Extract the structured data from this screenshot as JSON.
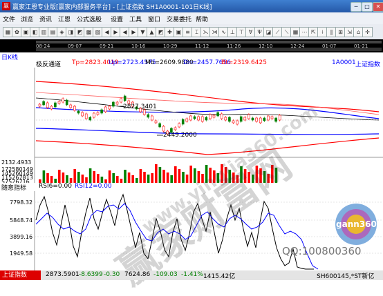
{
  "app": {
    "title": "赢家江恩专业版[赢家内部服务平台] - [上证指数  SH1A0001-101日K线]",
    "logo_text": "赢"
  },
  "window_buttons": [
    "─",
    "□",
    "✕"
  ],
  "menu": [
    "文件",
    "浏览",
    "资讯",
    "江恩",
    "公式选股",
    "设置",
    "工具",
    "窗口",
    "交易委托",
    "帮助"
  ],
  "toolbar": [
    "▦",
    "✿",
    "▣",
    "◧",
    "▥",
    "▤",
    "◈",
    "◨",
    "◩",
    "▩",
    "▧",
    "◀",
    "▶",
    "◀",
    "▶",
    "▼",
    "▲",
    "◩",
    "✚",
    "▣",
    "≡",
    "⌶",
    "⋋",
    "⋊",
    "∿",
    "⊥",
    "⊤",
    "∀",
    "Ψ",
    "◪",
    "⟋",
    "⟍",
    "▦",
    "⋯",
    "⇱",
    "⟊",
    "∥",
    "⊞",
    "⇲",
    "⌂",
    "✛"
  ],
  "date_ticks": [
    "08-24",
    "09-07",
    "09-21",
    "10-16",
    "10-29",
    "11-12",
    "11-26",
    "12-10",
    "12-24",
    "01-07",
    "01-21"
  ],
  "kline": {
    "title": "日K线",
    "indicator_name": "极反通道",
    "tp": "Tp=2823.4019",
    "up": "Up=2723.4575",
    "mb": "Mb=2609.9880",
    "dn": "Dn=2457.7656",
    "bt": "Bt=2319.6425",
    "code": "1A0001",
    "name": "上证指数",
    "high_label": "2827.3401",
    "low_label": "2449.2000",
    "left_axis_low": "2132.4933",
    "vol_labels": [
      "172580149",
      "145260149",
      "115267813",
      "57526716"
    ]
  },
  "indicator": {
    "name": "随意指标",
    "rsi6": "RSI6=0.00",
    "rsi12": "RSI12=0.00",
    "axis_labels": [
      "7798.32",
      "5848.74",
      "3899.16",
      "1949.58"
    ]
  },
  "status": {
    "tab_label": "上证指数",
    "sh_value": "2873.5901",
    "sh_change": "-8.6399",
    "sh_pct": "-0.30",
    "sz_value": "7624.86",
    "sz_change": "-109.03",
    "sz_pct": "-1.41%",
    "sz_amount": "1415.42亿",
    "stock_code": "SH600145,*ST新亿"
  },
  "watermark": {
    "qq": "QQ:100800360",
    "site": "www.yingjia360.com",
    "brand": "赢家财富网",
    "gann_logo": "gann360"
  },
  "colors": {
    "titlebar": "#2559a8",
    "up": "#ff0000",
    "down": "#008000",
    "channel_top": "#ff0000",
    "channel_mid": "#0000ff"
  }
}
